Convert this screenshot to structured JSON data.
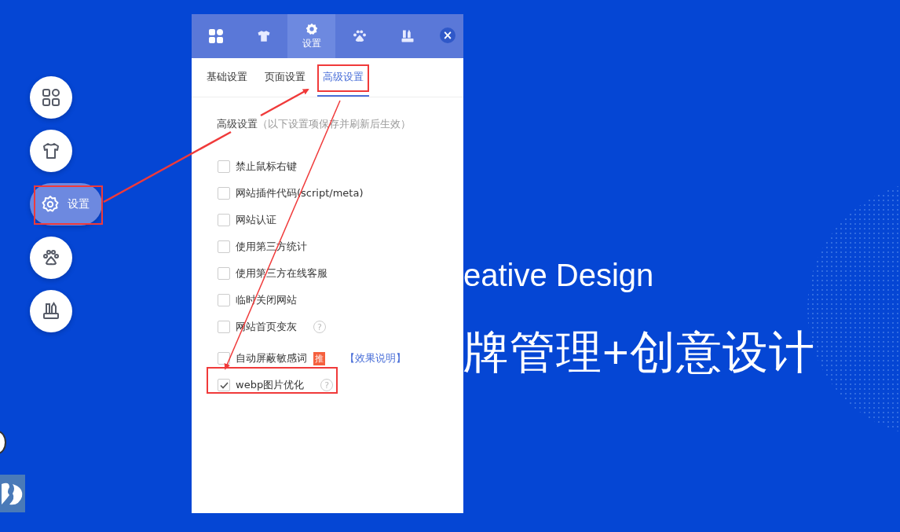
{
  "sidebar": {
    "items": [
      {
        "selected": false
      },
      {
        "selected": false
      },
      {
        "label": "设置",
        "selected": true
      },
      {
        "selected": false
      },
      {
        "selected": false
      }
    ]
  },
  "panel": {
    "tabs": [
      {
        "selected": false
      },
      {
        "selected": false
      },
      {
        "label": "设置",
        "selected": true
      },
      {
        "selected": false
      },
      {
        "selected": false
      }
    ],
    "close": "×",
    "subtabs": [
      {
        "label": "基础设置",
        "selected": false
      },
      {
        "label": "页面设置",
        "selected": false
      },
      {
        "label": "高级设置",
        "selected": true
      }
    ],
    "section_title": "高级设置",
    "section_note": "（以下设置项保存并刷新后生效）",
    "options": [
      {
        "label": "禁止鼠标右键",
        "checked": false
      },
      {
        "label": "网站插件代码(script/meta)",
        "checked": false
      },
      {
        "label": "网站认证",
        "checked": false
      },
      {
        "label": "使用第三方统计",
        "checked": false
      },
      {
        "label": "使用第三方在线客服",
        "checked": false
      },
      {
        "label": "临时关闭网站",
        "checked": false
      },
      {
        "label": "网站首页变灰",
        "checked": false,
        "help": "?"
      },
      {
        "label": "自动屏蔽敏感词",
        "checked": false,
        "badge": "推",
        "link": "【效果说明】"
      },
      {
        "label": "webp图片优化",
        "checked": true,
        "help": "?"
      }
    ]
  },
  "hero": {
    "line_1": "eative Design",
    "line_2": "牌管理+创意设计"
  }
}
